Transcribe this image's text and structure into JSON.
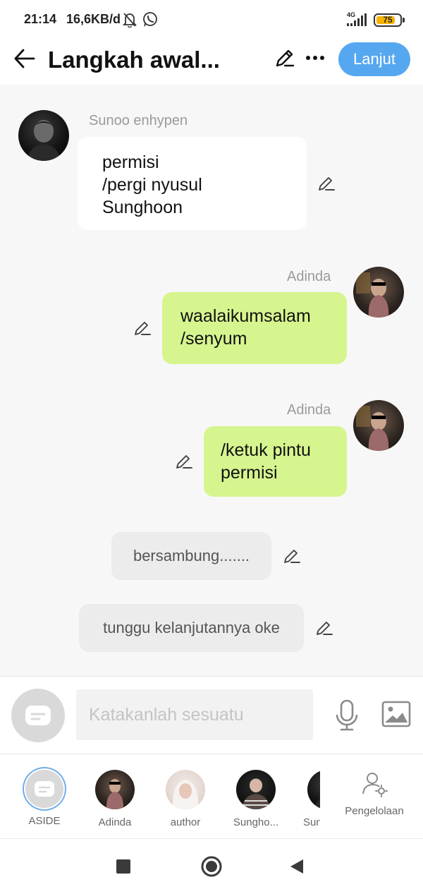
{
  "status_bar": {
    "time": "21:14",
    "speed": "16,6KB/d",
    "network": "4G",
    "battery": "75",
    "icons": [
      "bell-off-icon",
      "whatsapp-icon",
      "signal-icon",
      "battery-icon"
    ]
  },
  "header": {
    "title": "Langkah awal...",
    "next_label": "Lanjut",
    "accent_color": "#55a8f0"
  },
  "messages": [
    {
      "speaker": "Sunoo enhypen",
      "lines": [
        "permisi",
        "/pergi nyusul",
        "Sunghoon"
      ],
      "style": "white"
    },
    {
      "speaker": "Adinda",
      "lines": [
        "waalaikumsalam",
        "/senyum"
      ],
      "style": "green"
    },
    {
      "speaker": "Adinda",
      "lines": [
        "/ketuk pintu",
        "permisi"
      ],
      "style": "green"
    },
    {
      "speaker": "",
      "lines": [
        "bersambung......."
      ],
      "style": "grey"
    },
    {
      "speaker": "",
      "lines": [
        "tunggu kelanjutannya oke"
      ],
      "style": "grey"
    }
  ],
  "input": {
    "placeholder": "Katakanlah sesuatu"
  },
  "characters": [
    {
      "label": "ASIDE"
    },
    {
      "label": "Adinda"
    },
    {
      "label": "author"
    },
    {
      "label": "Sungho..."
    },
    {
      "label": "Sun"
    }
  ],
  "manage_label": "Pengelolaan",
  "colors": {
    "green_bubble": "#d6f58f",
    "white_bubble": "#ffffff",
    "grey_bubble": "#ececec",
    "chat_bg": "#f7f7f7"
  }
}
